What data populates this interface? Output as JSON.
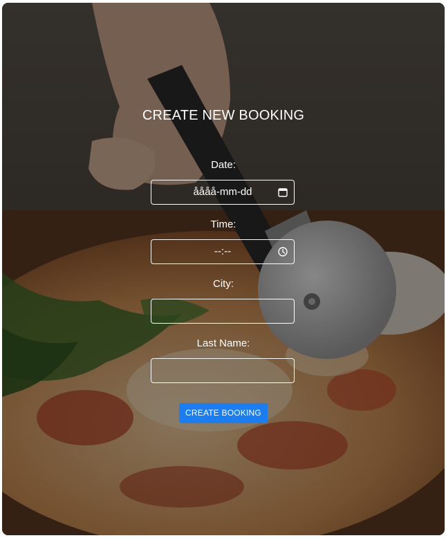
{
  "form": {
    "title": "CREATE NEW BOOKING",
    "date": {
      "label": "Date:",
      "display_value": "åååå-mm-dd",
      "icon": "calendar-icon"
    },
    "time": {
      "label": "Time:",
      "display_value": "--:--",
      "icon": "clock-icon"
    },
    "city": {
      "label": "City:",
      "value": ""
    },
    "last_name": {
      "label": "Last Name:",
      "value": ""
    },
    "submit_label": "CREATE BOOKING"
  },
  "colors": {
    "button": "#1a7ef2",
    "text": "#ffffff",
    "overlay": "rgba(0,0,0,0.42)"
  },
  "background": {
    "subject": "pizza-cutter-photo"
  }
}
